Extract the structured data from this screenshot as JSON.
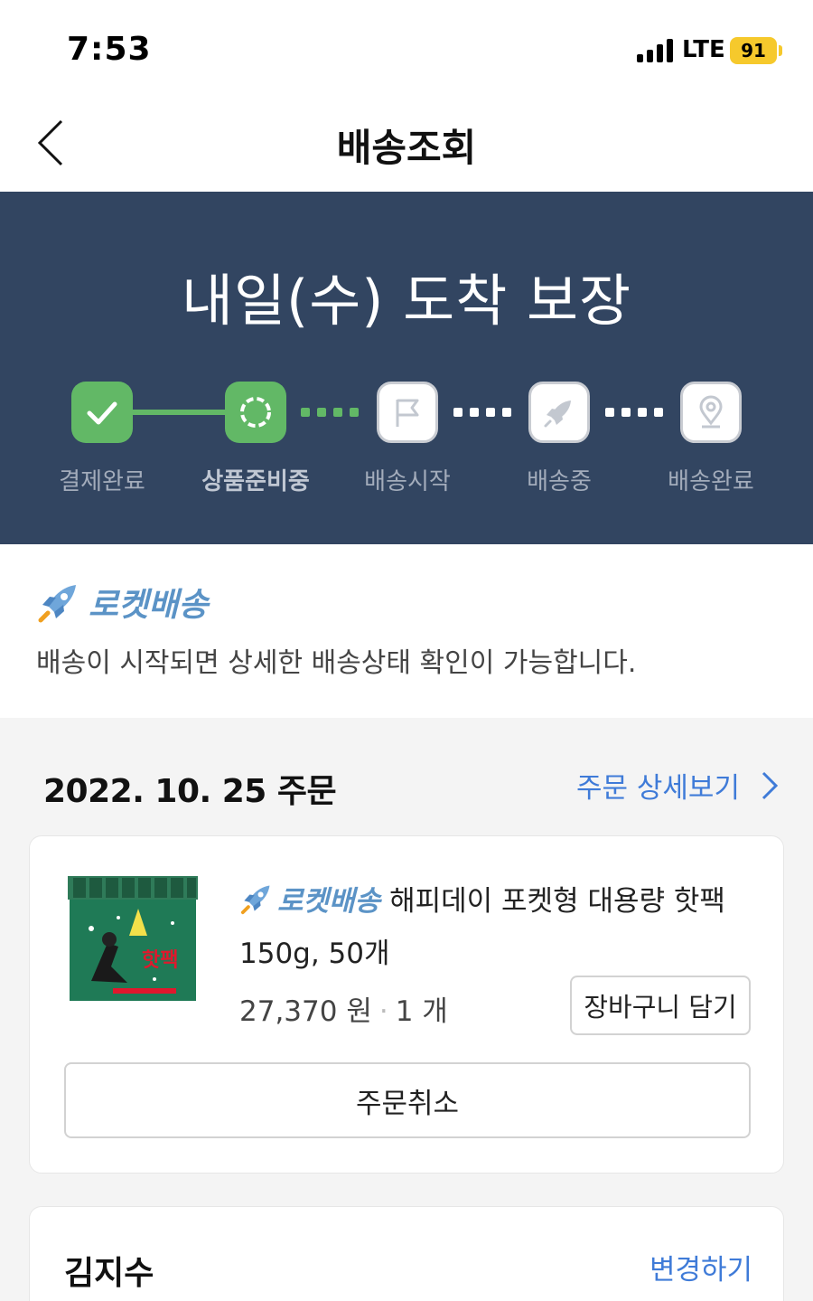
{
  "status_bar": {
    "time": "7:53",
    "network": "LTE",
    "battery": "91"
  },
  "nav": {
    "title": "배송조회"
  },
  "hero": {
    "title": "내일(수) 도착 보장",
    "steps": [
      {
        "label": "결제완료",
        "state": "done",
        "icon": "check-icon"
      },
      {
        "label": "상품준비중",
        "state": "current",
        "icon": "loading-ring-icon"
      },
      {
        "label": "배송시작",
        "state": "pending",
        "icon": "flag-icon"
      },
      {
        "label": "배송중",
        "state": "pending",
        "icon": "rocket-icon"
      },
      {
        "label": "배송완료",
        "state": "pending",
        "icon": "location-pin-icon"
      }
    ]
  },
  "rocket_delivery": {
    "name": "로켓배송",
    "description": "배송이 시작되면 상세한 배송상태 확인이 가능합니다."
  },
  "order": {
    "date_label": "2022. 10. 25 주문",
    "detail_link": "주문 상세보기",
    "product": {
      "badge": "로켓배송",
      "name_line1": "해피데이 포켓형 대용량 핫팩",
      "name_line2": "150g, 50개",
      "price": "27,370 원",
      "quantity": "1 개",
      "image_text": "핫팩"
    },
    "add_to_cart": "장바구니 담기",
    "cancel": "주문취소"
  },
  "recipient": {
    "name": "김지수",
    "change": "변경하기"
  },
  "colors": {
    "navy": "#324561",
    "green": "#62b866",
    "link_blue": "#3f7bd8",
    "rocket_blue": "#5b93c6",
    "battery_yellow": "#f6c92c"
  }
}
